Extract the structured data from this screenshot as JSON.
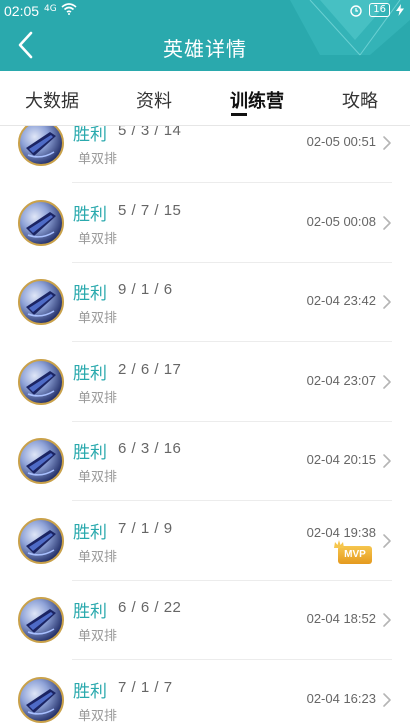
{
  "status_bar": {
    "time": "02:05",
    "signal_text": "4G",
    "battery": "16"
  },
  "header": {
    "title": "英雄详情",
    "back_icon": "chevron-left-icon",
    "color": "#2aa9ad"
  },
  "tabs": [
    {
      "label": "大数据",
      "active": false
    },
    {
      "label": "资料",
      "active": false
    },
    {
      "label": "训练营",
      "active": true
    },
    {
      "label": "攻略",
      "active": false
    }
  ],
  "matches": [
    {
      "result": "胜利",
      "kda": "5 / 3 / 14",
      "mode": "单双排",
      "datetime": "02-05 00:51",
      "mvp": false
    },
    {
      "result": "胜利",
      "kda": "5 / 7 / 15",
      "mode": "单双排",
      "datetime": "02-05 00:08",
      "mvp": false
    },
    {
      "result": "胜利",
      "kda": "9 / 1 / 6",
      "mode": "单双排",
      "datetime": "02-04 23:42",
      "mvp": false
    },
    {
      "result": "胜利",
      "kda": "2 / 6 / 17",
      "mode": "单双排",
      "datetime": "02-04 23:07",
      "mvp": false
    },
    {
      "result": "胜利",
      "kda": "6 / 3 / 16",
      "mode": "单双排",
      "datetime": "02-04 20:15",
      "mvp": false
    },
    {
      "result": "胜利",
      "kda": "7 / 1 / 9",
      "mode": "单双排",
      "datetime": "02-04 19:38",
      "mvp": true,
      "mvp_label": "MVP"
    },
    {
      "result": "胜利",
      "kda": "6 / 6 / 22",
      "mode": "单双排",
      "datetime": "02-04 18:52",
      "mvp": false
    },
    {
      "result": "胜利",
      "kda": "7 / 1 / 7",
      "mode": "单双排",
      "datetime": "02-04 16:23",
      "mvp": false
    }
  ]
}
